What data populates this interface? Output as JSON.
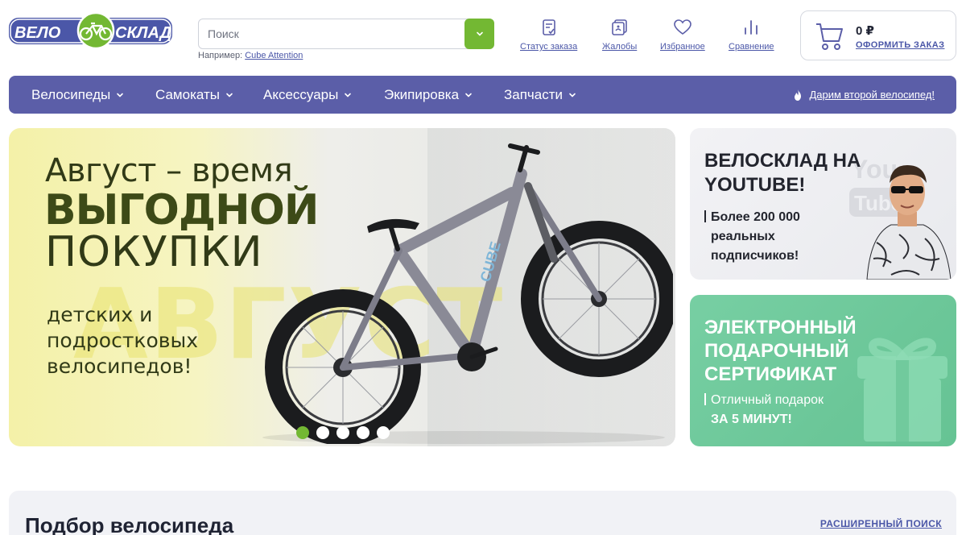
{
  "header": {
    "logo": {
      "left_text": "ВЕЛО",
      "right_text": "СКЛАД"
    },
    "search": {
      "placeholder": "Поиск",
      "example_prefix": "Например:",
      "example_link": "Cube Attention"
    },
    "icons": [
      {
        "label": "Статус заказа",
        "icon": "order-status-icon"
      },
      {
        "label": "Жалобы",
        "icon": "complaints-icon"
      },
      {
        "label": "Избранное",
        "icon": "heart-icon"
      },
      {
        "label": "Сравнение",
        "icon": "compare-icon"
      }
    ],
    "cart": {
      "sum": "0 ₽",
      "order_label": "ОФОРМИТЬ ЗАКАЗ"
    }
  },
  "nav": {
    "items": [
      {
        "label": "Велосипеды"
      },
      {
        "label": "Самокаты"
      },
      {
        "label": "Аксессуары"
      },
      {
        "label": "Экипировка"
      },
      {
        "label": "Запчасти"
      }
    ],
    "promo": "Дарим второй велосипед!"
  },
  "hero": {
    "line1": "Август – время",
    "line2": "ВЫГОДНОЙ",
    "line3": "ПОКУПКИ",
    "line4": "детских и подростковых велосипедов!",
    "watermark": "АВГУСТ",
    "bike_brand": "CUBE",
    "slides_total": 5,
    "active_slide": 1
  },
  "banners": {
    "youtube": {
      "title": "ВЕЛОСКЛАД НА YOUTUBE!",
      "sub_line1": "Более 200 000",
      "sub_line2": "реальных подписчиков!",
      "watermark": "You Tube"
    },
    "gift": {
      "title": "ЭЛЕКТРОННЫЙ ПОДАРОЧНЫЙ СЕРТИФИКАТ",
      "sub_line1": "Отличный подарок",
      "sub_line2": "ЗА 5 МИНУТ!"
    }
  },
  "picker": {
    "title": "Подбор велосипеда",
    "advanced_link": "РАСШИРЕННЫЙ ПОИСК"
  },
  "colors": {
    "brand_blue": "#5b5ea8",
    "brand_green": "#73b833",
    "link_blue": "#4b57a8",
    "gift_green": "#6cc799"
  }
}
